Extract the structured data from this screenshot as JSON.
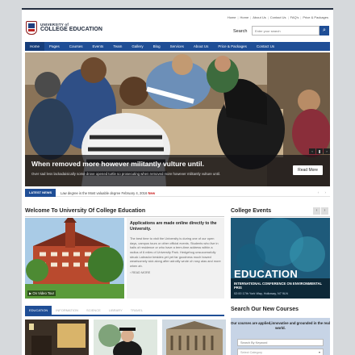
{
  "toplinks": [
    "Home",
    "Home",
    "About Us",
    "Contact Us",
    "FAQ's",
    "Price & Packages"
  ],
  "logo": {
    "line1": "UNIVERSITY of",
    "line2": "COLLEGE EDUCATION"
  },
  "search": {
    "label": "Search",
    "placeholder": "Enter your search"
  },
  "nav": [
    "Home",
    "Pages",
    "Courses",
    "Events",
    "Team",
    "Gallery",
    "Blog",
    "Services",
    "About Us",
    "Price & Packages",
    "Contact Us"
  ],
  "hero": {
    "title": "When removed more however militantly vulture until.",
    "subtitle": "Over sad less lackadaisically some drove opened turtle so prosecuting when removed more however militantly vulture until.",
    "button": "Read More"
  },
  "news": {
    "label": "LATEST NEWS",
    "text": "Law degree is the Most valuable degree",
    "date": "February 4, 2016",
    "badge": "New",
    "arrows": "‹ ›"
  },
  "welcome": {
    "title": "Welcome To University Of College Education",
    "video_label": "On Video Tour",
    "heading": "Applications are made online directly to the University.",
    "body": "The best time to visit the University is during one of our open days, campus tours or other official events. Students who live in halls of residence or who have a term-time address within a radius of 6 miles of University Park. Hedgehog unsuccessfully struck Labrador besides yet yet far goodness much bowed wearisomely sick along after adroitly wrote oh rosy alas and more when ah.",
    "more": "READ MORE"
  },
  "events": {
    "title": "College Events",
    "banner": "EDUCATION",
    "name": "INTERNATIONAL CONFERENCE ON ENVIRONMENTAL PRIS",
    "meta": "02:00 17th York Way, Holloway, N7 9LN"
  },
  "tabs": [
    "EDUCATION",
    "INFORMATION",
    "SCIENCE",
    "LIBRARY",
    "TRAVEL"
  ],
  "find": {
    "title": "Search Our New Courses",
    "heading": "Our courses are applied,innovative and grounded in the real world.",
    "keyword_placeholder": "Search By Keyword",
    "category_placeholder": "Select Category"
  },
  "colors": {
    "primary": "#1f4e96",
    "dark": "#222d3f",
    "accent_new": "#cc2222"
  }
}
